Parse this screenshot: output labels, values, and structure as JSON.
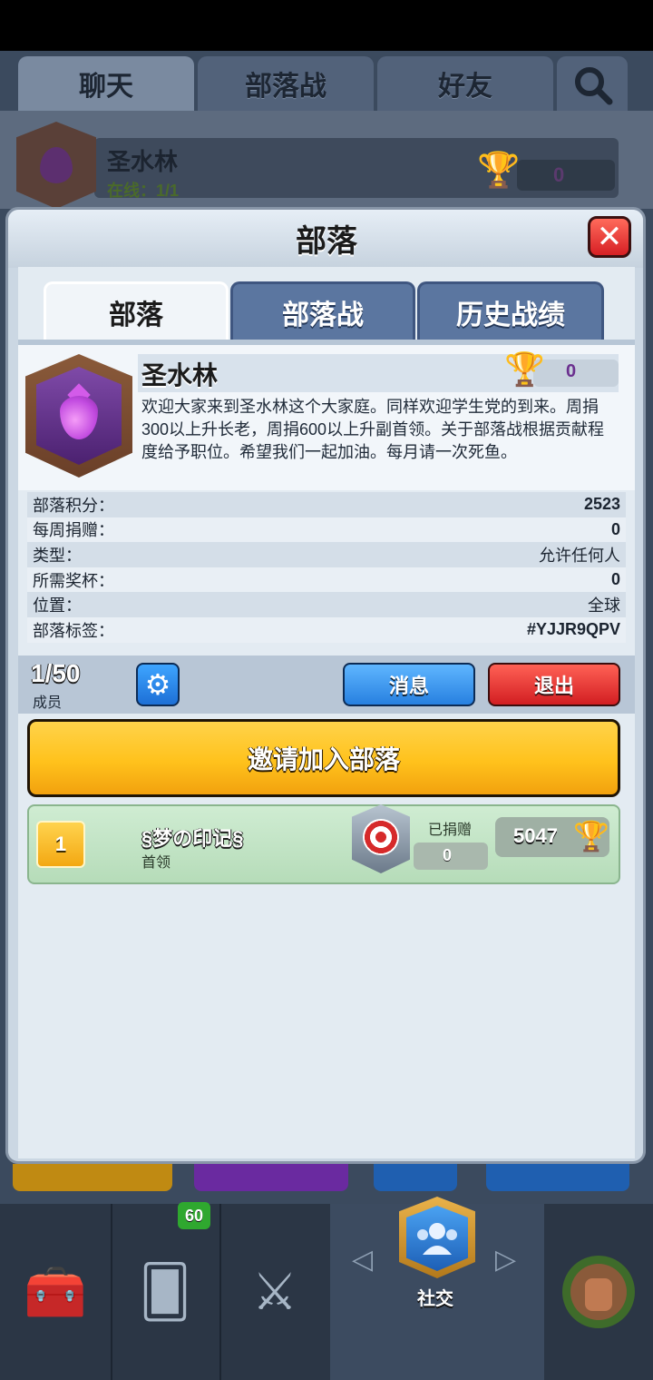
{
  "background": {
    "top_tabs": [
      "聊天",
      "部落战",
      "好友"
    ],
    "clan_name": "圣水林",
    "online": "在线：1/1",
    "trophies": "0"
  },
  "modal": {
    "title": "部落",
    "close_label": "✕",
    "tabs": [
      "部落",
      "部落战",
      "历史战绩"
    ],
    "active_tab": "部落"
  },
  "clan": {
    "name": "圣水林",
    "trophies": "0",
    "description": "欢迎大家来到圣水林这个大家庭。同样欢迎学生党的到来。周捐300以上升长老，周捐600以上升副首领。关于部落战根据贡献程度给予职位。希望我们一起加油。每月请一次死鱼。"
  },
  "stats": [
    {
      "label": "部落积分：",
      "value": "2523"
    },
    {
      "label": "每周捐赠：",
      "value": "0"
    },
    {
      "label": "类型：",
      "value": "允许任何人"
    },
    {
      "label": "所需奖杯：",
      "value": "0"
    },
    {
      "label": "位置：",
      "value": "全球"
    },
    {
      "label": "部落标签：",
      "value": "#YJJR9QPV"
    }
  ],
  "members_bar": {
    "count": "1/50",
    "label": "成员",
    "message_button": "消息",
    "exit_button": "退出"
  },
  "invite_button": "邀请加入部落",
  "member_list": [
    {
      "rank": "1",
      "name": "§梦の印记§",
      "role": "首领",
      "donated_label": "已捐赠",
      "donated": "0",
      "trophies": "5047"
    }
  ],
  "bottom_nav": {
    "active": "社交",
    "card_badge": "60",
    "social_label": "社交"
  },
  "icons": [
    "close-icon",
    "gear-icon",
    "trophy-icon",
    "search-icon",
    "elixir-drop-icon",
    "target-icon",
    "chest-icon",
    "cards-icon",
    "swords-icon",
    "social-icon"
  ],
  "colors": {
    "accent_yellow": "#ffc21c",
    "button_blue": "#2780e0",
    "button_red": "#d21e22"
  }
}
